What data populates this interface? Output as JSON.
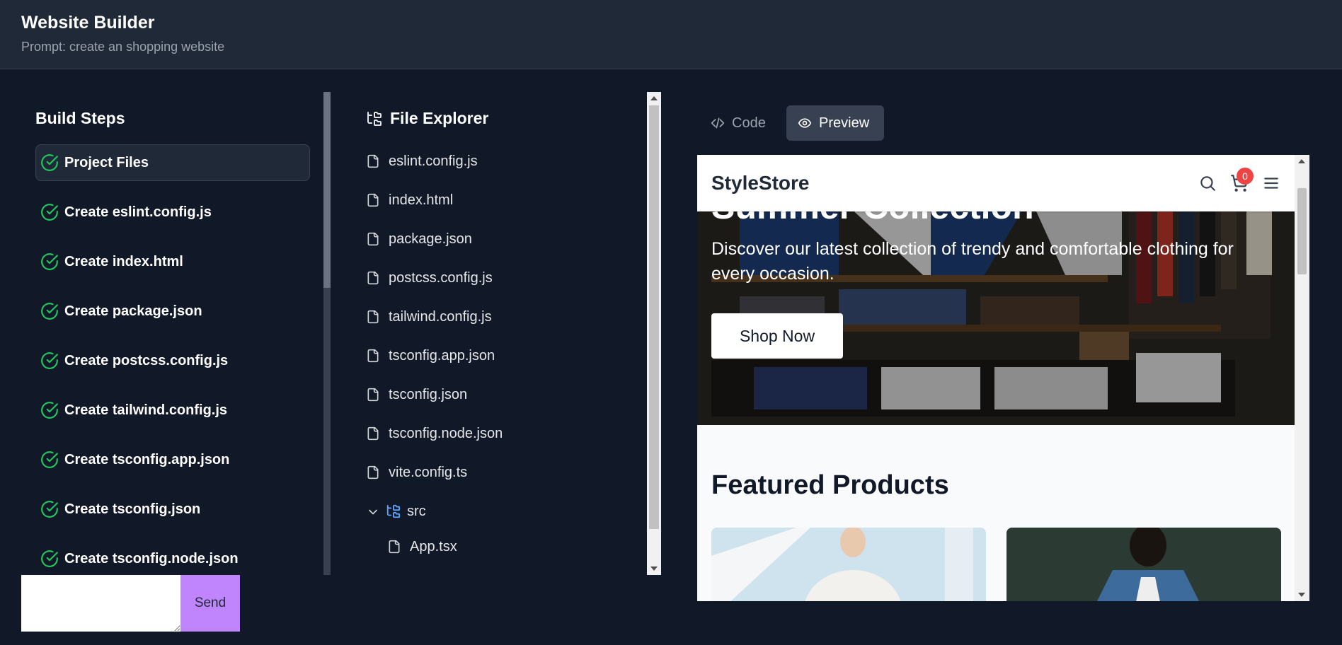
{
  "header": {
    "title": "Website Builder",
    "prompt": "Prompt: create an shopping website"
  },
  "steps": {
    "heading": "Build Steps",
    "items": [
      {
        "label": "Project Files",
        "status": "complete"
      },
      {
        "label": "Create eslint.config.js",
        "status": "complete"
      },
      {
        "label": "Create index.html",
        "status": "complete"
      },
      {
        "label": "Create package.json",
        "status": "complete"
      },
      {
        "label": "Create postcss.config.js",
        "status": "complete"
      },
      {
        "label": "Create tailwind.config.js",
        "status": "complete"
      },
      {
        "label": "Create tsconfig.app.json",
        "status": "complete"
      },
      {
        "label": "Create tsconfig.json",
        "status": "complete"
      },
      {
        "label": "Create tsconfig.node.json",
        "status": "complete"
      }
    ]
  },
  "chat": {
    "input_value": "",
    "send_label": "Send"
  },
  "explorer": {
    "heading": "File Explorer",
    "files": [
      "eslint.config.js",
      "index.html",
      "package.json",
      "postcss.config.js",
      "tailwind.config.js",
      "tsconfig.app.json",
      "tsconfig.json",
      "tsconfig.node.json",
      "vite.config.ts"
    ],
    "folder": {
      "name": "src",
      "files": [
        "App.tsx"
      ]
    }
  },
  "tabs": {
    "code": "Code",
    "preview": "Preview",
    "active": "preview"
  },
  "preview": {
    "store_name": "StyleStore",
    "cart_count": "0",
    "hero_title": "Summer Collection",
    "hero_subtitle": "Discover our latest collection of trendy and comfortable clothing for every occasion.",
    "shop_now": "Shop Now",
    "featured_title": "Featured Products"
  },
  "colors": {
    "background": "#111827",
    "header": "#1f2937",
    "check": "#22c55e",
    "send_button": "#c084fc",
    "cart_badge": "#ef4444",
    "folder_icon": "#60a5fa"
  }
}
